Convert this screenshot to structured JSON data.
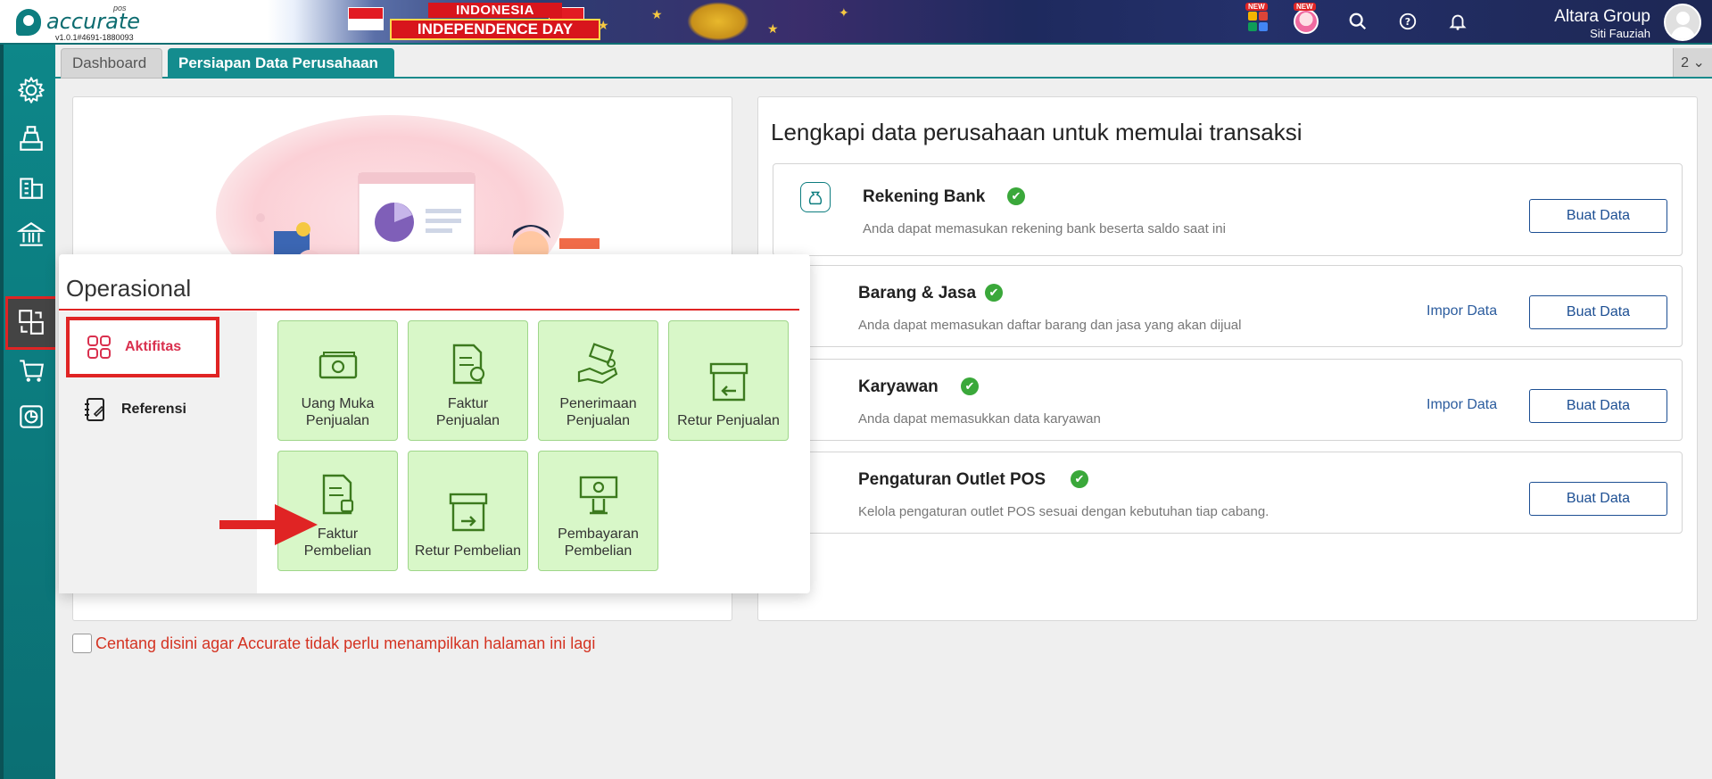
{
  "app": {
    "logo_text": "accurate",
    "logo_sub": "pos",
    "version": "v1.0.1#4691-1880093"
  },
  "banner": {
    "line1": "INDONESIA",
    "line2": "INDEPENDENCE DAY"
  },
  "header": {
    "new_badge": "NEW",
    "company": "Altara Group",
    "user": "Siti Fauziah"
  },
  "tabs": {
    "dashboard": "Dashboard",
    "active": "Persiapan Data Perusahaan",
    "count": "2 ⌄"
  },
  "setup": {
    "title": "Lengkapi data perusahaan untuk memulai transaksi",
    "rows": [
      {
        "title": "Rekening Bank",
        "desc": "Anda dapat memasukan rekening bank beserta saldo saat ini",
        "impor": "",
        "buat": "Buat Data"
      },
      {
        "title": "Barang & Jasa",
        "desc": "Anda dapat memasukan daftar barang dan jasa yang akan dijual",
        "impor": "Impor Data",
        "buat": "Buat Data"
      },
      {
        "title": "Karyawan",
        "desc": "Anda dapat memasukkan data karyawan",
        "impor": "Impor Data",
        "buat": "Buat Data"
      },
      {
        "title": "Pengaturan Outlet POS",
        "desc": "Kelola pengaturan outlet POS sesuai dengan kebutuhan tiap cabang.",
        "impor": "",
        "buat": "Buat Data"
      }
    ],
    "check_glyph": "✔"
  },
  "checkbox_label": "Centang disini agar Accurate tidak perlu menampilkan halaman ini lagi",
  "popup": {
    "title": "Operasional",
    "tabs": [
      {
        "label": "Aktifitas",
        "icon": "grid-apps-icon"
      },
      {
        "label": "Referensi",
        "icon": "notebook-edit-icon"
      }
    ],
    "tiles": [
      {
        "label1": "Uang Muka",
        "label2": "Penjualan",
        "icon": "cash-icon"
      },
      {
        "label1": "Faktur",
        "label2": "Penjualan",
        "icon": "invoice-sale-icon"
      },
      {
        "label1": "Penerimaan",
        "label2": "Penjualan",
        "icon": "hand-money-icon"
      },
      {
        "label1": "",
        "label2": "Retur Penjualan",
        "icon": "box-return-icon"
      },
      {
        "label1": "Faktur",
        "label2": "Pembelian",
        "icon": "invoice-purchase-icon"
      },
      {
        "label1": "",
        "label2": "Retur Pembelian",
        "icon": "box-return-out-icon"
      },
      {
        "label1": "Pembayaran",
        "label2": "Pembelian",
        "icon": "payment-hand-icon"
      }
    ]
  },
  "colors": {
    "teal": "#0d7d7f",
    "accent_red": "#e02424",
    "tile_green": "#d8f7c8",
    "icon_green": "#3c7a1e",
    "link_blue": "#1d4f93"
  }
}
